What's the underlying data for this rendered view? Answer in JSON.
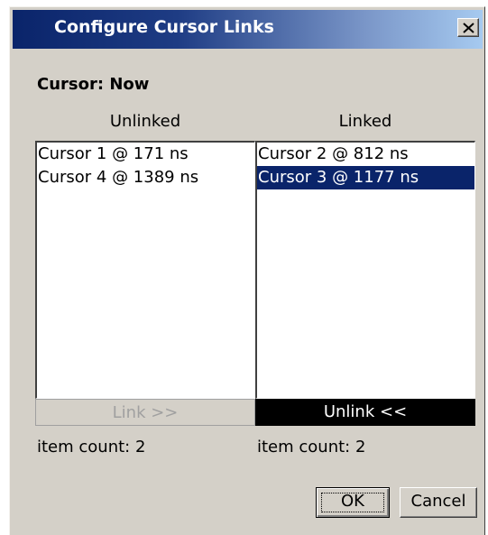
{
  "window": {
    "title": "Configure Cursor Links",
    "close_icon": "close-icon"
  },
  "cursor": {
    "label": "Cursor: Now"
  },
  "unlinked": {
    "header": "Unlinked",
    "items": [
      "Cursor 1 @ 171 ns",
      "Cursor 4 @ 1389 ns"
    ],
    "button_label": "Link >>",
    "count_text": "item count: 2"
  },
  "linked": {
    "header": "Linked",
    "items": [
      "Cursor 2 @ 812 ns",
      "Cursor 3 @ 1177 ns"
    ],
    "selected_index": 1,
    "button_label": "Unlink <<",
    "count_text": "item count: 2"
  },
  "footer": {
    "ok_label": "OK",
    "cancel_label": "Cancel"
  },
  "colors": {
    "title_bar": "#0a246a",
    "selection": "#0a246a",
    "dialog_bg": "#d4d0c8"
  }
}
